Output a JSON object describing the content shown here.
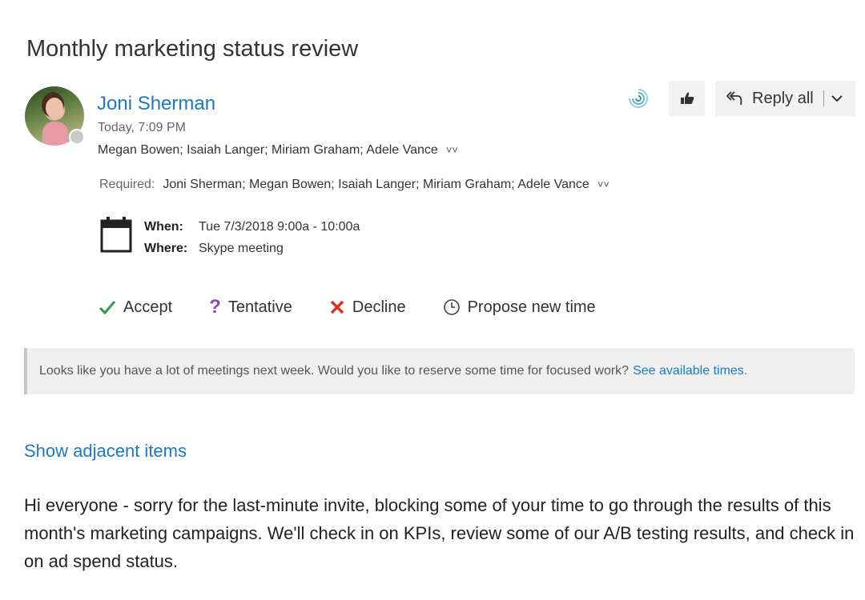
{
  "message": {
    "subject": "Monthly marketing status review",
    "sender": "Joni Sherman",
    "timestamp": "Today, 7:09 PM",
    "to": "Megan Bowen; Isaiah Langer; Miriam Graham; Adele Vance",
    "required_label": "Required:",
    "required": "Joni Sherman; Megan Bowen; Isaiah Langer; Miriam Graham; Adele Vance",
    "when_label": "When:",
    "when": "Tue 7/3/2018 9:00a - 10:00a",
    "where_label": "Where:",
    "where": "Skype meeting"
  },
  "toolbar": {
    "reply_all_label": "Reply all",
    "icons": [
      "insights-ring-icon",
      "thumbs-up-icon",
      "reply-all-icon",
      "chevron-down-icon"
    ]
  },
  "responses": {
    "accept": "Accept",
    "tentative": "Tentative",
    "decline": "Decline",
    "propose": "Propose new time"
  },
  "banner": {
    "text": "Looks like you have a lot of meetings next week. Would you like to reserve some time for focused work?",
    "link": "See available times."
  },
  "show_adjacent": "Show adjacent items",
  "body": "Hi everyone - sorry for the last-minute invite, blocking some of your time to go through the results of this month's marketing campaigns. We'll check in on KPIs, review some of our A/B testing results, and check in on ad spend status.",
  "colors": {
    "link": "#1a7ac7",
    "accept": "#2e9a4a",
    "tentative": "#8a4ac8",
    "decline": "#d9301f"
  }
}
